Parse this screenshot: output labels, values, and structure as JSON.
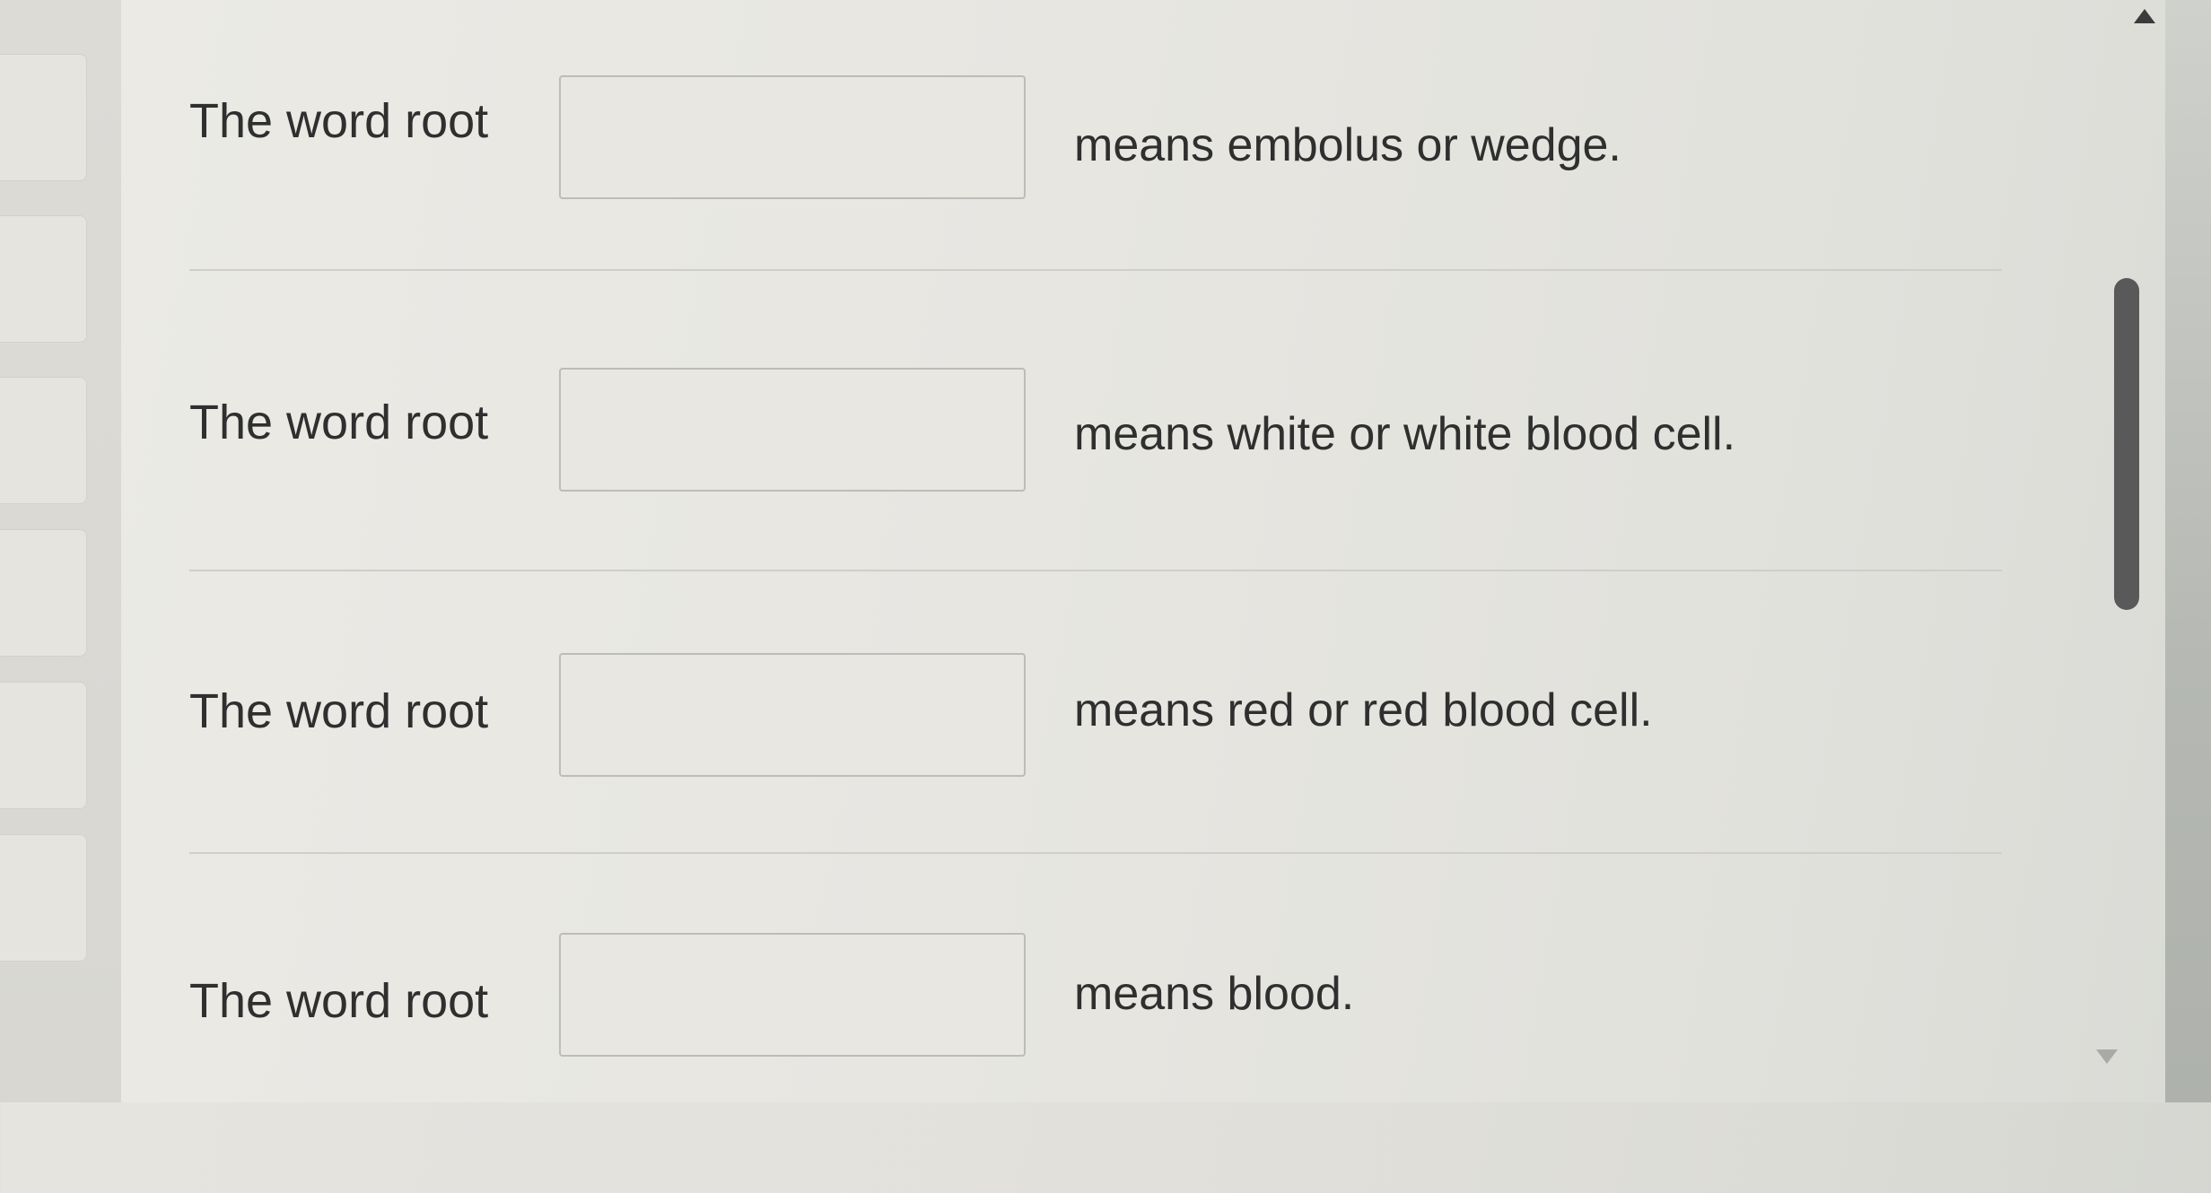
{
  "questions": [
    {
      "lead": "The word root",
      "answer": "",
      "tail": "means embolus or wedge."
    },
    {
      "lead": "The word root",
      "answer": "",
      "tail": "means white or white blood cell."
    },
    {
      "lead": "The word root",
      "answer": "",
      "tail": "means red or red blood cell."
    },
    {
      "lead": "The word root",
      "answer": "",
      "tail": "means blood."
    }
  ],
  "scrollbar": {
    "up_icon": "arrow-up-icon",
    "down_icon": "arrow-down-icon"
  }
}
